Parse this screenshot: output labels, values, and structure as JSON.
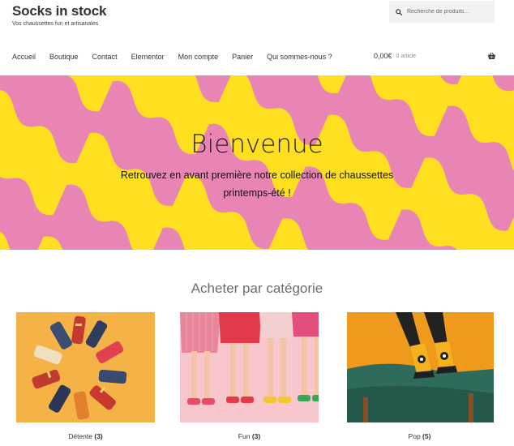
{
  "site": {
    "title": "Socks in stock",
    "tagline": "Vos chaussettes fun et artisanales"
  },
  "search": {
    "placeholder": "Recherche de produits…",
    "icon": "search-icon"
  },
  "nav": {
    "items": [
      "Accueil",
      "Boutique",
      "Contact",
      "Elementor",
      "Mon compte",
      "Panier",
      "Qui sommes-nous ?"
    ]
  },
  "cart": {
    "amount": "0,00€",
    "count": "0 article",
    "icon": "basket-icon"
  },
  "hero": {
    "title": "Bienvenue",
    "line1": "Retrouvez en avant première notre collection de chaussettes",
    "line2": "printemps-été !",
    "colors": {
      "yellow": "#ffe020",
      "pink": "#e985b4"
    }
  },
  "categories": {
    "heading": "Acheter par catégorie",
    "items": [
      {
        "name": "Détente",
        "count": "(3)"
      },
      {
        "name": "Fun",
        "count": "(3)"
      },
      {
        "name": "Pop",
        "count": "(5)"
      }
    ]
  }
}
